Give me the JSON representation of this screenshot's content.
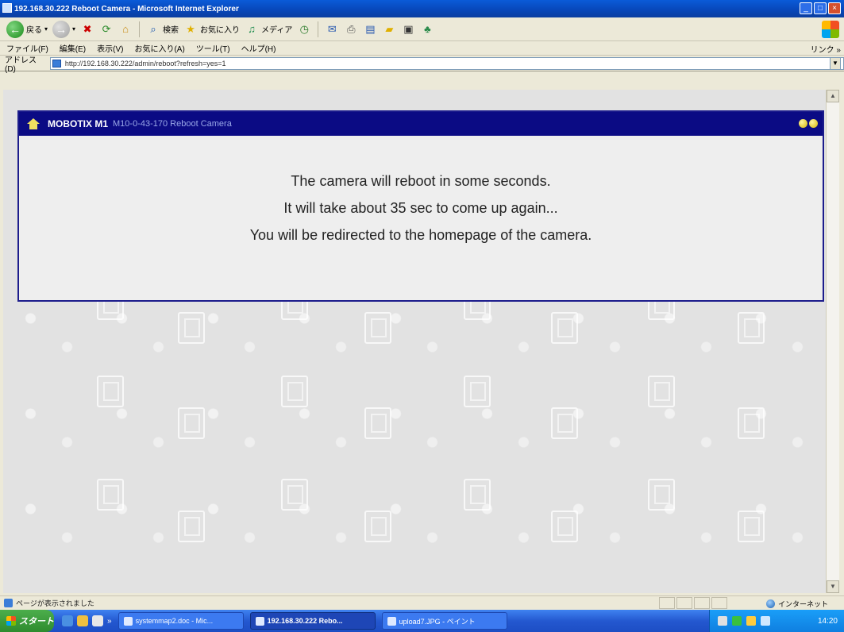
{
  "window": {
    "title": "192.168.30.222 Reboot Camera - Microsoft Internet Explorer",
    "minimize": "_",
    "maximize": "□",
    "close": "×"
  },
  "toolbar": {
    "back_label": "戻る",
    "search_label": "検索",
    "favorites_label": "お気に入り",
    "media_label": "メディア"
  },
  "menubar": {
    "items": [
      "ファイル(F)",
      "編集(E)",
      "表示(V)",
      "お気に入り(A)",
      "ツール(T)",
      "ヘルプ(H)"
    ],
    "links_label": "リンク »"
  },
  "address": {
    "label": "アドレス(D)",
    "url": "http://192.168.30.222/admin/reboot?refresh=yes=1"
  },
  "panel": {
    "brand": "MOBOTIX M1",
    "subtitle": "M10-0-43-170 Reboot Camera",
    "messages": [
      "The camera will reboot in some seconds.",
      "It will take about 35 sec to come up again...",
      "You will be redirected to the homepage of the camera."
    ]
  },
  "statusbar": {
    "text": "ページが表示されました",
    "zone": "インターネット"
  },
  "taskbar": {
    "start_label": "スタート",
    "quicklaunch_more": "»",
    "tasks": [
      {
        "label": "systemmap2.doc - Mic..."
      },
      {
        "label": "192.168.30.222 Rebo..."
      },
      {
        "label": "upload7.JPG - ペイント"
      }
    ],
    "clock": "14:20"
  },
  "colors": {
    "panel_header": "#0b0b84",
    "panel_border": "#1c1c8c",
    "taskbar": "#2458d0",
    "start_button": "#2e8b2e",
    "titlebar": "#0846b8"
  }
}
